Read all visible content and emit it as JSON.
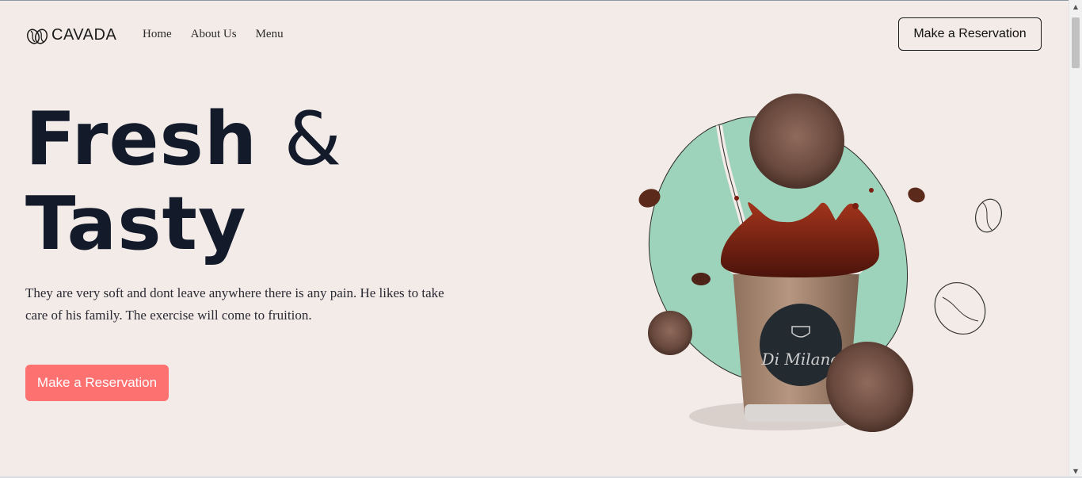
{
  "brand": {
    "name": "CAVADA"
  },
  "nav": {
    "items": [
      "Home",
      "About Us",
      "Menu"
    ]
  },
  "header": {
    "cta_label": "Make a Reservation"
  },
  "hero": {
    "title_line1_word": "Fresh",
    "title_line1_amp": "&",
    "title_line2": "Tasty",
    "description": "They are very soft and dont leave anywhere there is any pain. He likes to take care of his family. The exercise will come to fruition.",
    "cta_label": "Make a Reservation",
    "cup_label": "Di Milano"
  },
  "colors": {
    "background": "#f3ebe8",
    "heading": "#131a2a",
    "primary_button": "#fe7171",
    "blob": "#9dd3bb"
  },
  "icons": [
    "coffee-bean-logo-icon",
    "scroll-up-arrow-icon",
    "scroll-down-arrow-icon"
  ]
}
